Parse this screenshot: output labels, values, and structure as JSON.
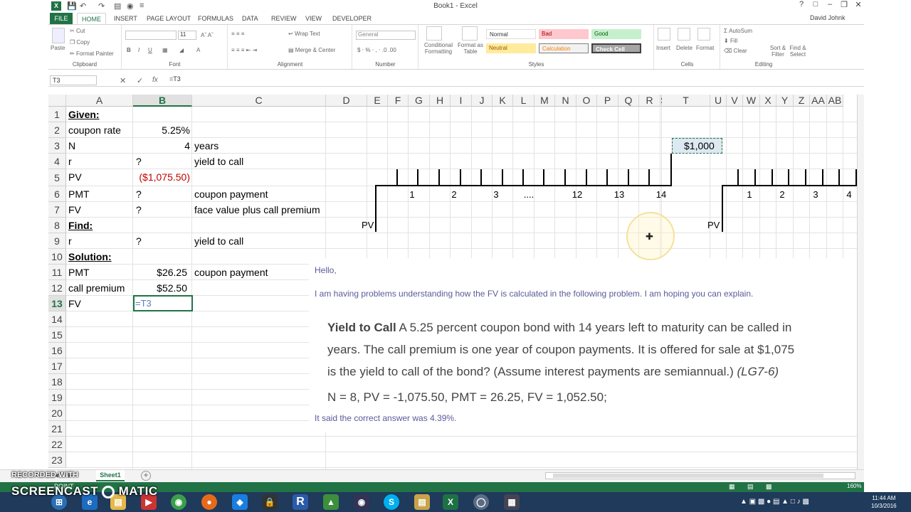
{
  "window": {
    "title": "Book1 - Excel",
    "user": "David Johnk"
  },
  "ribbon_tabs": [
    "FILE",
    "HOME",
    "INSERT",
    "PAGE LAYOUT",
    "FORMULAS",
    "DATA",
    "REVIEW",
    "VIEW",
    "DEVELOPER"
  ],
  "ribbon": {
    "clipboard": {
      "label": "Clipboard",
      "paste": "Paste",
      "cut": "Cut",
      "copy": "Copy",
      "format_painter": "Format Painter"
    },
    "font": {
      "label": "Font",
      "size": "11"
    },
    "alignment": {
      "label": "Alignment",
      "wrap": "Wrap Text",
      "merge": "Merge & Center"
    },
    "number": {
      "label": "Number",
      "format": "General"
    },
    "styles": {
      "label": "Styles",
      "cond": "Conditional Formatting",
      "format_table": "Format as Table",
      "normal": "Normal",
      "bad": "Bad",
      "good": "Good",
      "neutral": "Neutral",
      "calculation": "Calculation",
      "check_cell": "Check Cell"
    },
    "cells": {
      "label": "Cells",
      "insert": "Insert",
      "delete": "Delete",
      "format": "Format"
    },
    "editing": {
      "label": "Editing",
      "autosum": "AutoSum",
      "fill": "Fill",
      "clear": "Clear",
      "sort": "Sort & Filter",
      "find": "Find & Select"
    }
  },
  "formula_bar": {
    "name_box": "T3",
    "formula": "=T3"
  },
  "columns": [
    "A",
    "B",
    "C",
    "D",
    "E",
    "F",
    "G",
    "H",
    "I",
    "J",
    "K",
    "L",
    "M",
    "N",
    "O",
    "P",
    "Q",
    "R",
    "S",
    "T",
    "U",
    "V",
    "W",
    "X",
    "Y",
    "Z",
    "AA",
    "AB"
  ],
  "rows": [
    "1",
    "2",
    "3",
    "4",
    "5",
    "6",
    "7",
    "8",
    "9",
    "10",
    "11",
    "12",
    "13",
    "14",
    "15",
    "16",
    "17",
    "18",
    "19",
    "20",
    "21",
    "22",
    "23"
  ],
  "cells": {
    "a1": "Given:",
    "a2": "coupon rate",
    "b2": "5.25%",
    "a3": "N",
    "b3": "4",
    "c3": "years",
    "a4": "r",
    "b4": "?",
    "c4": "yield to call",
    "a5": "PV",
    "b5": "($1,075.50)",
    "a6": "PMT",
    "b6": "?",
    "c6": "coupon payment",
    "a7": "FV",
    "b7": "?",
    "c7": "face value plus call premium",
    "a8": "Find:",
    "a9": "r",
    "b9": "?",
    "c9": "yield to call",
    "a10": "Solution:",
    "a11": "PMT",
    "b11": "$26.25",
    "c11": "coupon payment",
    "a12": "call premium",
    "b12": "$52.50",
    "a13": "FV",
    "b13": "=T3",
    "t3": "$1,000"
  },
  "timeline": {
    "labels_left": [
      "1",
      "2",
      "3",
      "....",
      "12",
      "13",
      "14"
    ],
    "labels_right": [
      "1",
      "2",
      "3",
      "4"
    ],
    "pv_label": "PV"
  },
  "note": {
    "hello": "Hello,",
    "line1": "I am having problems understanding how the FV is calculated in the following problem. I am hoping you can explain.",
    "q_title": "Yield to Call",
    "q1": " A 5.25 percent coupon bond with 14 years left to maturity can be called in",
    "q2": "years. The call premium is one year of coupon payments. It is offered for sale at $1,075",
    "q3": "is the yield to call of the bond? (Assume interest payments are semiannual.)",
    "q_ref": "(LG7-6)",
    "given": "N = 8, PV = -1,075.50, PMT = 26.25, FV = 1,052.50;",
    "answer": "It said the correct answer was 4.39%."
  },
  "sheet_tab": "Sheet1",
  "status": {
    "mode": "POINT",
    "zoom": "160%"
  },
  "clock": {
    "time": "11:44 AM",
    "date": "10/3/2016"
  },
  "watermark": {
    "line1": "RECORDED WITH",
    "line2": "SCREENCAST",
    "line3": "MATIC"
  }
}
